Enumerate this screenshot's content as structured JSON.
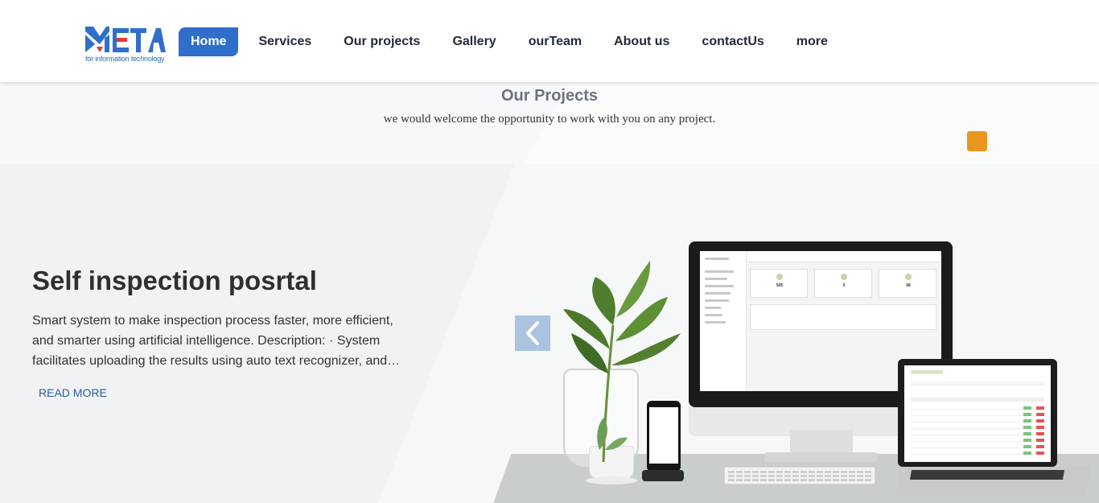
{
  "brand": {
    "logo_text": "META",
    "logo_tagline": "for information technology",
    "colors": {
      "blue": "#2f6fcb",
      "red": "#e53935",
      "accent_orange": "#e8961f"
    }
  },
  "nav": {
    "items": [
      {
        "label": "Home",
        "active": true
      },
      {
        "label": "Services",
        "active": false
      },
      {
        "label": "Our projects",
        "active": false
      },
      {
        "label": "Gallery",
        "active": false
      },
      {
        "label": "ourTeam",
        "active": false
      },
      {
        "label": "About us",
        "active": false
      },
      {
        "label": "contactUs",
        "active": false
      },
      {
        "label": "more",
        "active": false
      }
    ]
  },
  "projects": {
    "title": "Our Projects",
    "subtitle": "we would welcome the opportunity to work with you on any project."
  },
  "slide": {
    "title": "Self inspection posrtal",
    "description": "Smart system to make inspection process faster, more efficient, and smarter using artificial intelligence. Description: · System facilitates uploading the results using auto text recognizer, and…",
    "read_more": "READ MORE",
    "prev_icon": "chevron-left-icon"
  },
  "dashboard_mock": {
    "stats": [
      "505",
      "5",
      "68"
    ]
  }
}
